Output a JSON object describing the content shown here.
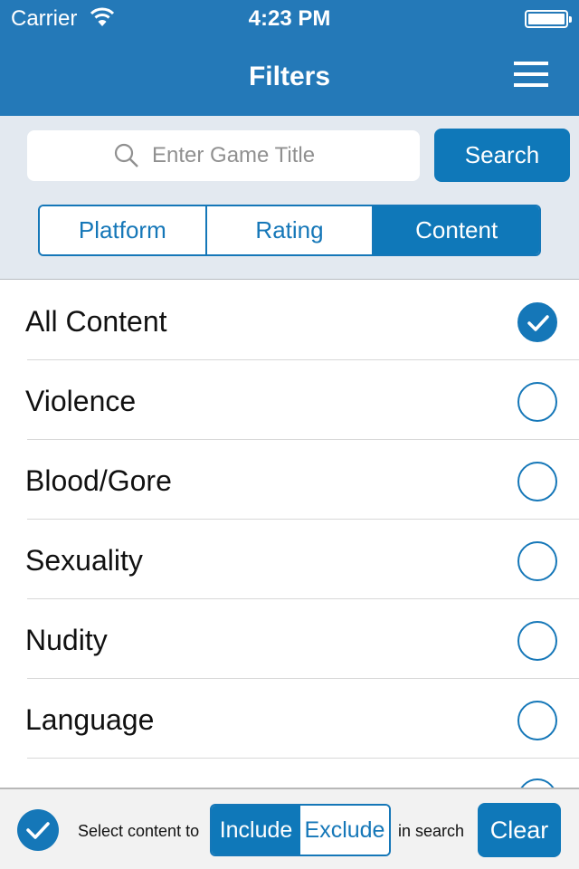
{
  "status_bar": {
    "carrier": "Carrier",
    "time": "4:23 PM"
  },
  "nav": {
    "title": "Filters",
    "menu_icon": "hamburger-menu-icon"
  },
  "search": {
    "placeholder": "Enter Game Title",
    "value": "",
    "button_label": "Search"
  },
  "segments": [
    {
      "label": "Platform",
      "active": false
    },
    {
      "label": "Rating",
      "active": false
    },
    {
      "label": "Content",
      "active": true
    }
  ],
  "content_items": [
    {
      "label": "All Content",
      "checked": true
    },
    {
      "label": "Violence",
      "checked": false
    },
    {
      "label": "Blood/Gore",
      "checked": false
    },
    {
      "label": "Sexuality",
      "checked": false
    },
    {
      "label": "Nudity",
      "checked": false
    },
    {
      "label": "Language",
      "checked": false
    }
  ],
  "bottom_bar": {
    "prefix_text": "Select content to",
    "include_label": "Include",
    "exclude_label": "Exclude",
    "selected_mode": "Include",
    "suffix_text": "in search",
    "clear_label": "Clear",
    "toggle_checked": true
  },
  "colors": {
    "brand": "#2479b8",
    "accent": "#1577b8",
    "panel_bg": "#e3e9f0"
  }
}
